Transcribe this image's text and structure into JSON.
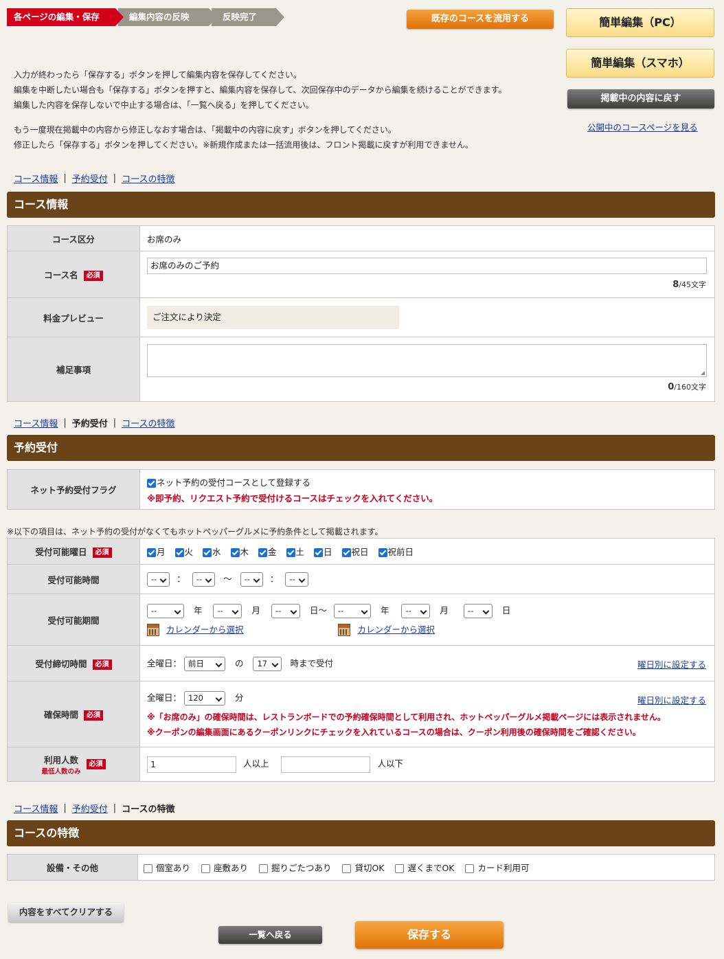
{
  "steps": [
    "各ページの編集・保存",
    "編集内容の反映",
    "反映完了"
  ],
  "buttons": {
    "reuse_course": "既存のコースを流用する",
    "simple_edit_pc": "簡単編集（PC）",
    "simple_edit_sp": "簡単編集（スマホ）",
    "revert_published": "掲載中の内容に戻す",
    "view_public_page": "公開中のコースページを見る",
    "clear_all": "内容をすべてクリアする",
    "back_to_list": "一覧へ戻る",
    "save": "保存する"
  },
  "intro": [
    "入力が終わったら「保存する」ボタンを押して編集内容を保存してください。",
    "編集を中断したい場合も「保存する」ボタンを押すと、編集内容を保存して、次回保存中のデータから編集を続けることができます。",
    "編集した内容を保存しないで中止する場合は、「一覧へ戻る」を押してください。",
    "もう一度現在掲載中の内容から修正しなおす場合は、「掲載中の内容に戻す」ボタンを押してください。",
    "修正したら「保存する」ボタンを押してください。※新規作成または一括流用後は、フロント掲載に戻すが利用できません。"
  ],
  "nav": {
    "course_info": "コース情報",
    "reservation": "予約受付",
    "features": "コースの特徴"
  },
  "required_label": "必須",
  "course_info": {
    "heading": "コース情報",
    "category_label": "コース区分",
    "category_value": "お席のみ",
    "name_label": "コース名",
    "name_value": "お席のみのご予約",
    "name_count": "8",
    "name_max": "/45文字",
    "price_label": "料金プレビュー",
    "price_value": "ご注文により決定",
    "supplement_label": "補足事項",
    "supplement_count": "0",
    "supplement_max": "/160文字"
  },
  "reservation": {
    "heading": "予約受付",
    "net_flag_label": "ネット予約受付フラグ",
    "net_flag_text": "ネット予約の受付コースとして登録する",
    "net_flag_note": "※即予約、リクエスト予約で受付けるコースはチェックを入れてください。",
    "general_note": "※以下の項目は、ネット予約の受付がなくてもホットペッパーグルメに予約条件として掲載されます。",
    "days_label": "受付可能曜日",
    "days": [
      "月",
      "火",
      "水",
      "木",
      "金",
      "土",
      "日",
      "祝日",
      "祝前日"
    ],
    "time_label": "受付可能時間",
    "time_placeholder": "--",
    "time_colon": "：",
    "time_tilde": "〜",
    "period_label": "受付可能期間",
    "unit_year": "年",
    "unit_month": "月",
    "unit_day": "日",
    "unit_day_tilde": "日～",
    "calendar_link": "カレンダーから選択",
    "deadline_label": "受付締切時間",
    "all_days": "全曜日：",
    "deadline_day": "前日",
    "deadline_no": "の",
    "deadline_hour": "17",
    "deadline_suffix": "時まで受付",
    "per_day_link": "曜日別に設定する",
    "hold_label": "確保時間",
    "hold_value": "120",
    "hold_unit": "分",
    "hold_note1": "※「お席のみ」の確保時間は、レストランボードでの予約確保時間として利用され、ホットペッパーグルメ掲載ページには表示されません。",
    "hold_note2": "※クーポンの編集画面にあるクーポンリンクにチェックを入れているコースの場合は、クーポン利用後の確保時間をご確認ください。",
    "people_label": "利用人数",
    "people_sub": "最低人数のみ",
    "people_min": "1",
    "people_min_suffix": "人以上",
    "people_max_suffix": "人以下"
  },
  "features": {
    "heading": "コースの特徴",
    "facilities_label": "設備・その他",
    "options": [
      "個室あり",
      "座敷あり",
      "掘りごたつあり",
      "貸切OK",
      "遅くまでOK",
      "カード利用可"
    ]
  }
}
